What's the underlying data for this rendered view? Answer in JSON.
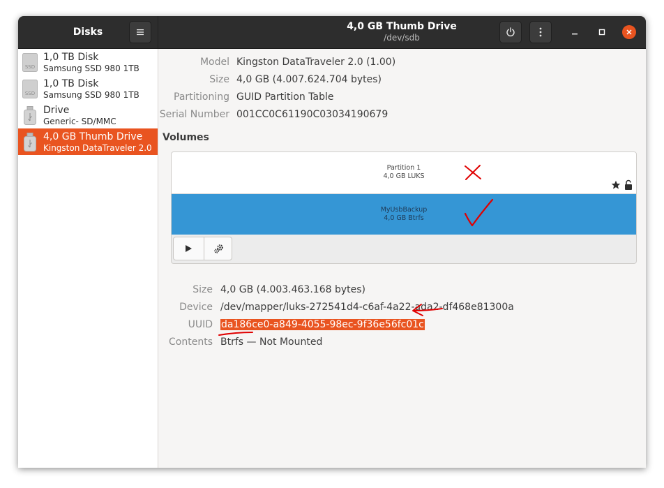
{
  "app": {
    "sidebar_title": "Disks",
    "title": "4,0 GB Thumb Drive",
    "subtitle": "/dev/sdb"
  },
  "icons": {
    "menu": "hamburger-menu-icon",
    "power": "power-icon",
    "more": "vertical-dots-icon",
    "minimize": "minimize-icon",
    "maximize": "maximize-icon",
    "close": "close-icon",
    "ssd": "ssd-drive-icon",
    "usb": "usb-drive-icon",
    "star": "star-icon",
    "lock": "lock-icon",
    "play": "play-icon",
    "settings": "gears-icon"
  },
  "colors": {
    "accent": "#e95420",
    "partition_selected": "#3596d5",
    "headerbar": "#2d2d2d",
    "annotation_red": "#e00000"
  },
  "sidebar": {
    "items": [
      {
        "name": "1,0 TB Disk",
        "model": "Samsung SSD 980 1TB",
        "icon": "ssd",
        "icon_label": "SSD",
        "selected": false
      },
      {
        "name": "1,0 TB Disk",
        "model": "Samsung SSD 980 1TB",
        "icon": "ssd",
        "icon_label": "SSD",
        "selected": false
      },
      {
        "name": "Drive",
        "model": "Generic- SD/MMC",
        "icon": "usb",
        "selected": false
      },
      {
        "name": "4,0 GB Thumb Drive",
        "model": "Kingston DataTraveler 2.0",
        "icon": "usb",
        "selected": true
      }
    ]
  },
  "drive": {
    "model_label": "Model",
    "model_value": "Kingston DataTraveler 2.0 (1.00)",
    "size_label": "Size",
    "size_value": "4,0 GB (4.007.624.704 bytes)",
    "partitioning_label": "Partitioning",
    "partitioning_value": "GUID Partition Table",
    "serial_label": "Serial Number",
    "serial_value": "001CC0C61190C03034190679"
  },
  "volumes": {
    "heading": "Volumes",
    "partitions": [
      {
        "name": "Partition 1",
        "detail": "4,0 GB LUKS",
        "selected": false
      },
      {
        "name": "MyUsbBackup",
        "detail": "4,0 GB Btrfs",
        "selected": true
      }
    ]
  },
  "selected_volume": {
    "size_label": "Size",
    "size_value": "4,0 GB (4.003.463.168 bytes)",
    "device_label": "Device",
    "device_value": "/dev/mapper/luks-272541d4-c6af-4a22-ada2-df468e81300a",
    "uuid_label": "UUID",
    "uuid_value": "da186ce0-a849-4055-98ec-9f36e56fc01c",
    "contents_label": "Contents",
    "contents_fs": "Btrfs",
    "contents_rest": " — Not Mounted"
  },
  "annotations": {
    "cross_mark": "red-x-mark",
    "check_mark": "red-check-mark",
    "arrow": "red-arrow-left",
    "underline": "red-underline"
  }
}
